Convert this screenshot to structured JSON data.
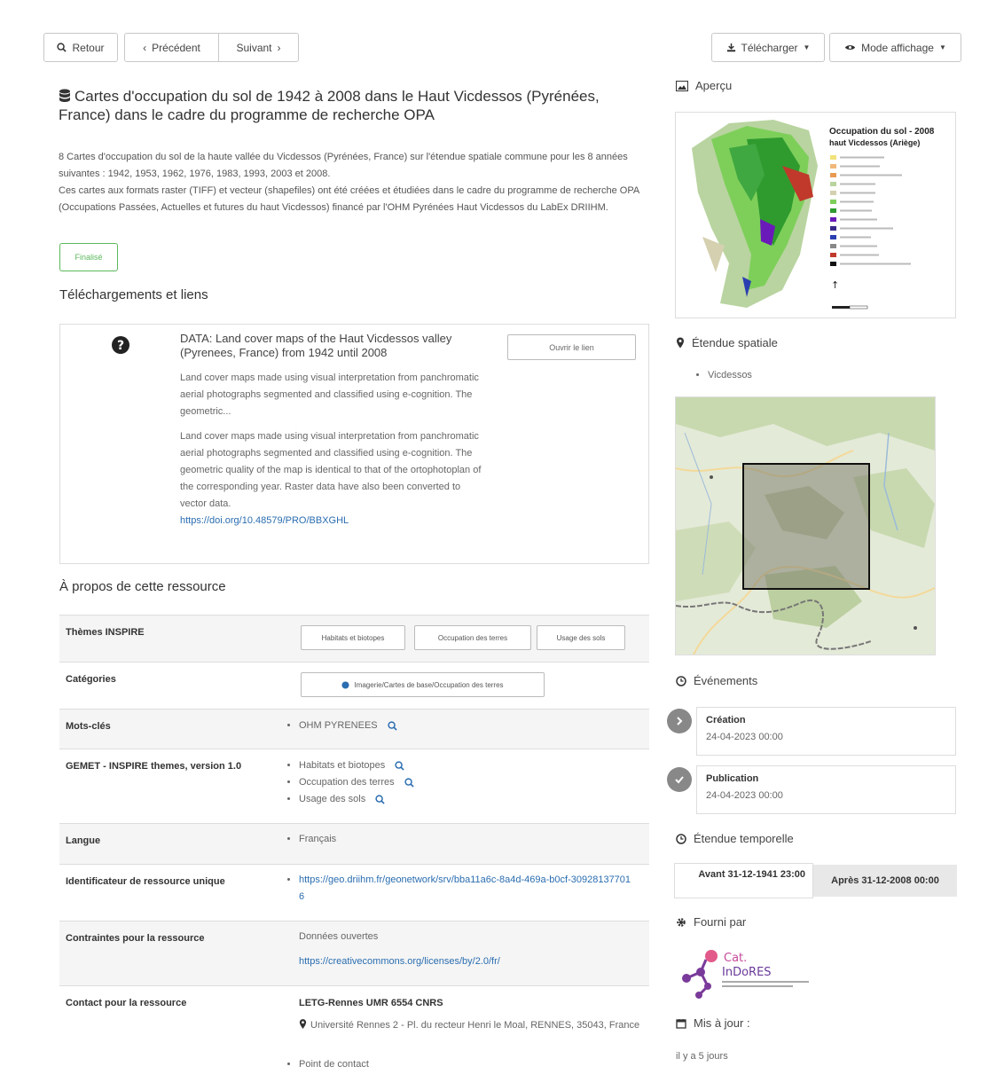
{
  "toolbar": {
    "back": "Retour",
    "previous": "Précédent",
    "next": "Suivant",
    "download": "Télécharger",
    "view_mode": "Mode affichage"
  },
  "record": {
    "title": "Cartes d'occupation du sol de 1942 à 2008 dans le Haut Vicdessos (Pyrénées, France) dans le cadre du programme de recherche OPA",
    "abstract_line1": "8 Cartes d'occupation du sol de la haute vallée du Vicdessos (Pyrénées, France) sur l'étendue spatiale commune pour les 8 années suivantes : 1942, 1953, 1962, 1976, 1983, 1993, 2003 et 2008.",
    "abstract_line2": "Ces cartes aux formats raster (TIFF) et vecteur (shapefiles) ont été créées et étudiées dans le cadre du programme de recherche OPA (Occupations Passées, Actuelles et futures du haut Vicdessos) financé par l'OHM Pyrénées Haut Vicdessos du LabEx DRIIHM.",
    "status": "Finalisé"
  },
  "downloads": {
    "heading": "Téléchargements et liens",
    "link_title": "DATA: Land cover maps of the Haut Vicdessos valley (Pyrenees, France) from 1942 until 2008",
    "short_desc": "Land cover maps made using visual interpretation from panchromatic aerial photographs segmented and classified using e-cognition. The geometric...",
    "full_desc": "Land cover maps made using visual interpretation from panchromatic aerial photographs segmented and classified using e-cognition. The geometric quality of the map is identical to that of the ortophotoplan of the corresponding year. Raster data have also been converted to vector data.",
    "doi": "https://doi.org/10.48579/PRO/BBXGHL",
    "open_link": "Ouvrir le lien"
  },
  "about": {
    "heading": "À propos de cette ressource",
    "inspire_label": "Thèmes INSPIRE",
    "inspire_tags": [
      "Habitats et biotopes",
      "Occupation des terres",
      "Usage des sols"
    ],
    "categories_label": "Catégories",
    "category": "Imagerie/Cartes de base/Occupation des terres",
    "keywords_label": "Mots-clés",
    "keyword": "OHM PYRENEES",
    "gemet_label": "GEMET - INSPIRE themes, version 1.0",
    "gemet_items": [
      "Habitats et biotopes",
      "Occupation des terres",
      "Usage des sols"
    ],
    "language_label": "Langue",
    "language": "Français",
    "identifier_label": "Identificateur de ressource unique",
    "identifier": "https://geo.driihm.fr/geonetwork/srv/bba11a6c-8a4d-469a-b0cf-309281377016",
    "constraints_label": "Contraintes pour la ressource",
    "constraints_value": "Données ouvertes",
    "license": "https://creativecommons.org/licenses/by/2.0/fr/",
    "contact_label": "Contact pour la ressource",
    "contact_org": "LETG-Rennes UMR 6554 CNRS",
    "contact_address": "Université Rennes 2 - Pl. du recteur Henri le Moal, RENNES, 35043, France",
    "contact_point": "Point de contact"
  },
  "sidebar": {
    "preview_heading": "Aperçu",
    "legend_title": "Occupation du sol - 2008",
    "legend_subtitle": "haut Vicdessos (Ariège)",
    "spatial_heading": "Étendue spatiale",
    "place": "Vicdessos",
    "events_heading": "Événements",
    "creation_label": "Création",
    "creation_date": "24-04-2023 00:00",
    "publication_label": "Publication",
    "publication_date": "24-04-2023 00:00",
    "temporal_heading": "Étendue temporelle",
    "before": "Avant 31-12-1941 23:00",
    "after": "Après 31-12-2008 00:00",
    "provided_heading": "Fourni par",
    "provider_logo_text1": "Cat.",
    "provider_logo_text2": "InDoRES",
    "updated_heading": "Mis à jour :",
    "updated_value": "il y a 5 jours"
  }
}
